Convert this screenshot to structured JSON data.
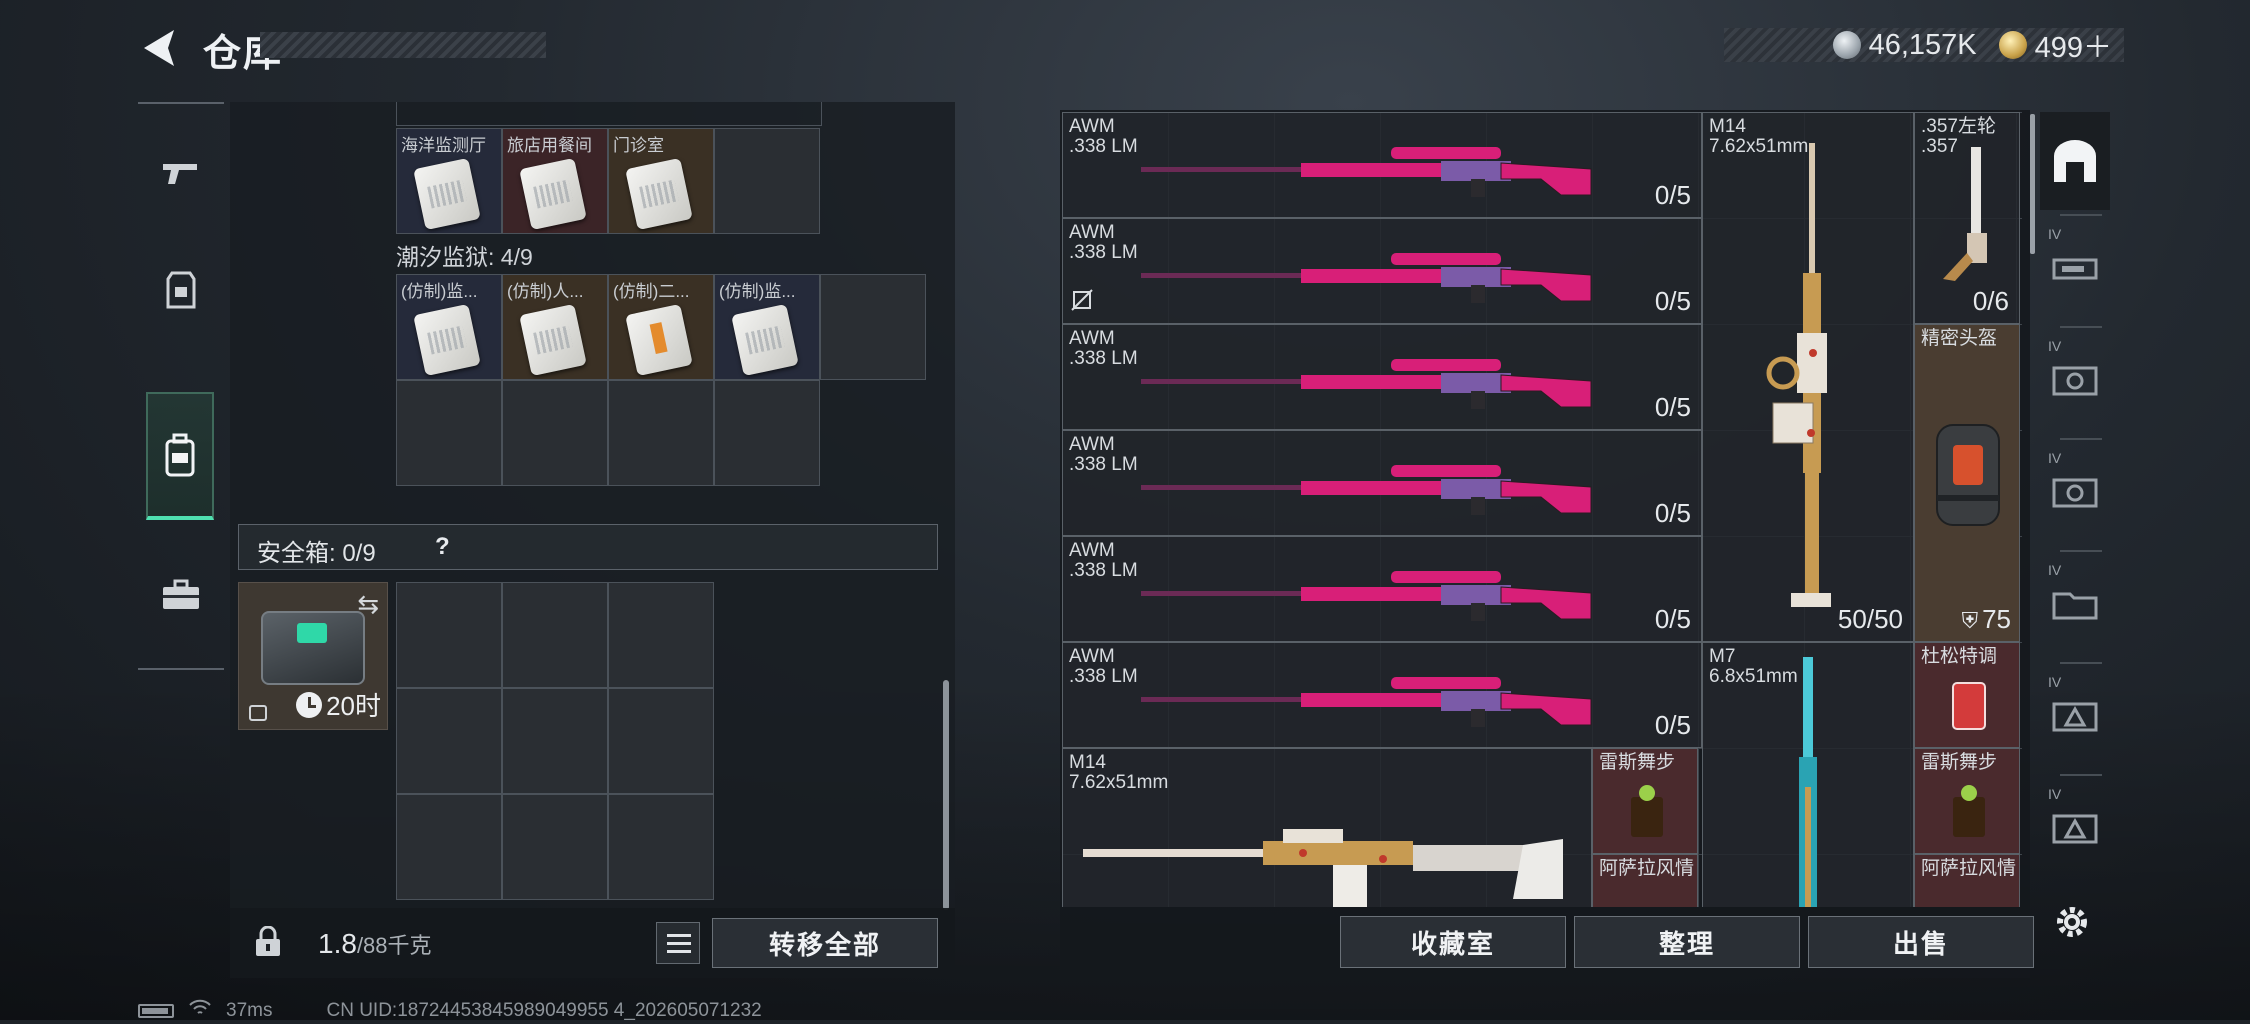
{
  "header": {
    "title": "仓库",
    "currency_silver": "46,157K",
    "currency_gold": "499＋"
  },
  "left_nav": {
    "items": [
      "weapons",
      "equipment",
      "backpack",
      "toolbox"
    ]
  },
  "inventory": {
    "row1": [
      {
        "label": "海洋监测厅",
        "tone": "bluish"
      },
      {
        "label": "旅店用餐间",
        "tone": "reddish"
      },
      {
        "label": "门诊室",
        "tone": "brownish"
      }
    ],
    "section_title": "潮汐监狱: 4/9",
    "row2": [
      {
        "label": "(仿制)监...",
        "tone": "bluish"
      },
      {
        "label": "(仿制)人...",
        "tone": "brownish"
      },
      {
        "label": "(仿制)二...",
        "tone": "brownish",
        "card": "orange"
      },
      {
        "label": "(仿制)监...",
        "tone": "bluish"
      }
    ]
  },
  "safe_box": {
    "label": "安全箱: 0/9",
    "help": "?",
    "timer": "20时"
  },
  "footer_left": {
    "weight_value": "1.8",
    "weight_unit": "/88千克",
    "transfer_all": "转移全部"
  },
  "status_bar": {
    "ping": "37ms",
    "uid": "CN UID:18724453845989049955 4_202605071232"
  },
  "stash": {
    "awm": [
      {
        "name": "AWM",
        "ammo": ".338 LM",
        "count": "0/5",
        "no_durability": false
      },
      {
        "name": "AWM",
        "ammo": ".338 LM",
        "count": "0/5",
        "no_durability": true
      },
      {
        "name": "AWM",
        "ammo": ".338 LM",
        "count": "0/5",
        "no_durability": false
      },
      {
        "name": "AWM",
        "ammo": ".338 LM",
        "count": "0/5",
        "no_durability": false
      },
      {
        "name": "AWM",
        "ammo": ".338 LM",
        "count": "0/5",
        "no_durability": false
      },
      {
        "name": "AWM",
        "ammo": ".338 LM",
        "count": "0/5",
        "no_durability": false
      }
    ],
    "m14_tall": {
      "name": "M14",
      "ammo": "7.62x51mm",
      "count": "50/50"
    },
    "revolver": {
      "name": ".357左轮",
      "ammo": ".357",
      "count": "0/6"
    },
    "helmet": {
      "name": "精密头盔",
      "durability": "75"
    },
    "m7": {
      "name": "M7",
      "ammo": "6.8x51mm"
    },
    "drink1": {
      "name": "杜松特调"
    },
    "m14_wide": {
      "name": "M14",
      "ammo": "7.62x51mm"
    },
    "rum_left": {
      "name": "雷斯舞步"
    },
    "asala_left": {
      "name": "阿萨拉风情"
    },
    "rum_right": {
      "name": "雷斯舞步"
    },
    "asala_right": {
      "name": "阿萨拉风情"
    }
  },
  "footer_right": {
    "collection": "收藏室",
    "sort": "整理",
    "sell": "出售"
  },
  "right_rail": {
    "tiers": [
      "IV",
      "IV",
      "IV",
      "IV",
      "IV"
    ]
  },
  "colors": {
    "accent": "#4fe0b0",
    "skin_pink": "#d81f78"
  }
}
